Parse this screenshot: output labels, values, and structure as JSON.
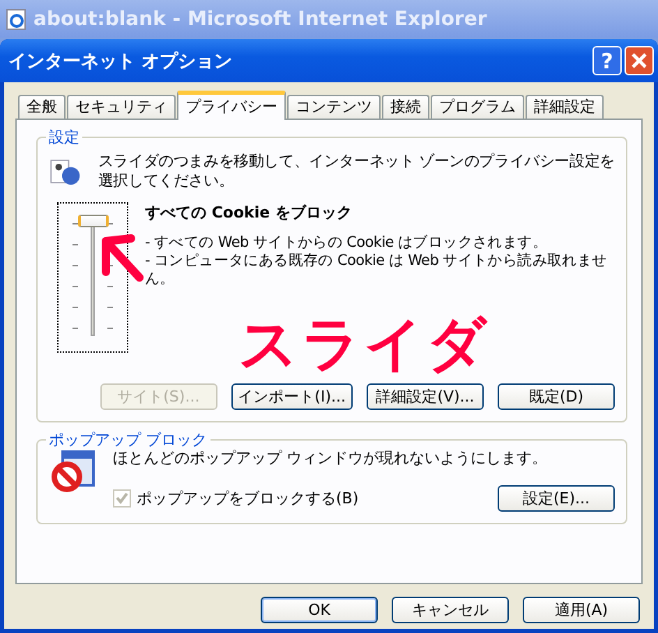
{
  "background_window": {
    "title": "about:blank - Microsoft Internet Explorer"
  },
  "dialog": {
    "title": "インターネット オプション",
    "help": "?"
  },
  "tabs": [
    {
      "label": "全般",
      "selected": false
    },
    {
      "label": "セキュリティ",
      "selected": false
    },
    {
      "label": "プライバシー",
      "selected": true
    },
    {
      "label": "コンテンツ",
      "selected": false
    },
    {
      "label": "接続",
      "selected": false
    },
    {
      "label": "プログラム",
      "selected": false
    },
    {
      "label": "詳細設定",
      "selected": false
    }
  ],
  "settings": {
    "group_title": "設定",
    "instruction": "スライダのつまみを移動して、インターネット ゾーンのプライバシー設定を選択してください。",
    "slider": {
      "level": 1
    },
    "level_title": "すべての Cookie をブロック",
    "level_description": [
      "- すべての Web サイトからの Cookie はブロックされます。",
      "- コンピュータにある既存の Cookie は Web サイトから読み取れません。"
    ],
    "buttons": [
      {
        "label": "サイト(S)...",
        "disabled": true
      },
      {
        "label": "インポート(I)...",
        "disabled": false
      },
      {
        "label": "詳細設定(V)...",
        "disabled": false
      },
      {
        "label": "既定(D)",
        "disabled": false
      }
    ]
  },
  "popup": {
    "group_title": "ポップアップ ブロック",
    "description": "ほとんどのポップアップ ウィンドウが現れないようにします。",
    "checkbox": {
      "label": "ポップアップをブロックする(B)",
      "checked": true,
      "disabled": true
    },
    "settings_button": "設定(E)..."
  },
  "footer_buttons": [
    {
      "label": "OK",
      "default": true
    },
    {
      "label": "キャンセル",
      "default": false
    },
    {
      "label": "適用(A)",
      "default": false
    }
  ],
  "annotation": {
    "text": "スライダ"
  }
}
